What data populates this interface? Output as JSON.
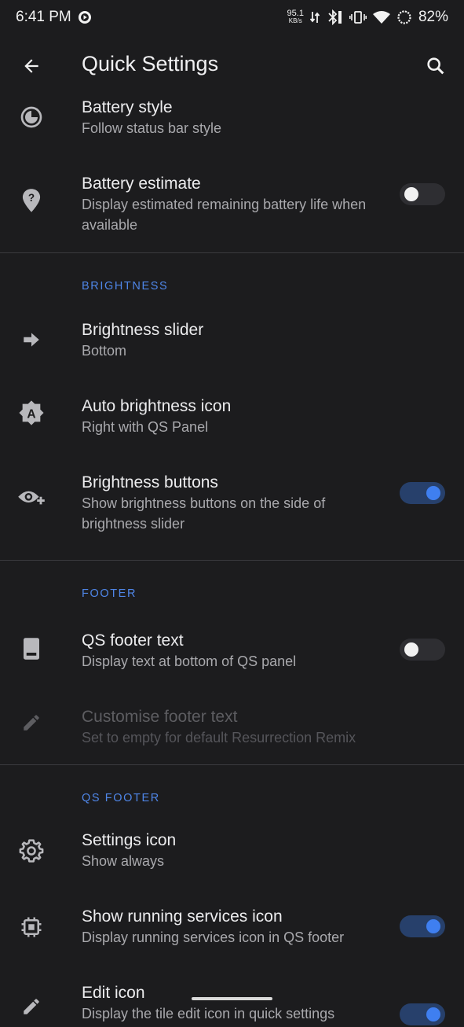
{
  "status_bar": {
    "time": "6:41 PM",
    "net_speed": "95.1",
    "net_unit": "KB/s",
    "battery": "82%"
  },
  "app_bar": {
    "title": "Quick Settings",
    "back_icon": "arrow-left-icon",
    "search_icon": "search-icon"
  },
  "items": [
    {
      "title": "Battery style",
      "summary": "Follow status bar style",
      "icon": "battery-style-icon"
    },
    {
      "title": "Battery estimate",
      "summary": "Display estimated remaining battery life when available",
      "icon": "location-question-icon",
      "toggle": false
    }
  ],
  "sections": [
    {
      "header": "BRIGHTNESS",
      "items": [
        {
          "title": "Brightness slider",
          "summary": "Bottom",
          "icon": "arrow-right-icon"
        },
        {
          "title": "Auto brightness icon",
          "summary": "Right with QS Panel",
          "icon": "auto-brightness-icon"
        },
        {
          "title": "Brightness buttons",
          "summary": "Show brightness buttons on the side of brightness slider",
          "icon": "eye-plus-icon",
          "toggle": true
        }
      ]
    },
    {
      "header": "FOOTER",
      "items": [
        {
          "title": "QS footer text",
          "summary": "Display text at bottom of QS panel",
          "icon": "tablet-icon",
          "toggle": false
        },
        {
          "title": "Customise footer text",
          "summary": "Set to empty for default Resurrection Remix",
          "icon": "pencil-icon",
          "disabled": true
        }
      ]
    },
    {
      "header": "QS FOOTER",
      "items": [
        {
          "title": "Settings icon",
          "summary": "Show always",
          "icon": "gear-icon"
        },
        {
          "title": "Show running services icon",
          "summary": "Display running services icon in QS footer",
          "icon": "chip-icon",
          "toggle": true
        },
        {
          "title": "Edit icon",
          "summary": "Display the tile edit icon in quick settings",
          "icon": "pencil-icon",
          "toggle": true
        }
      ]
    }
  ],
  "colors": {
    "background": "#1c1c1e",
    "accent": "#4f86e8",
    "toggle_on_track": "#27406b",
    "toggle_on_knob": "#3f7ff0"
  }
}
